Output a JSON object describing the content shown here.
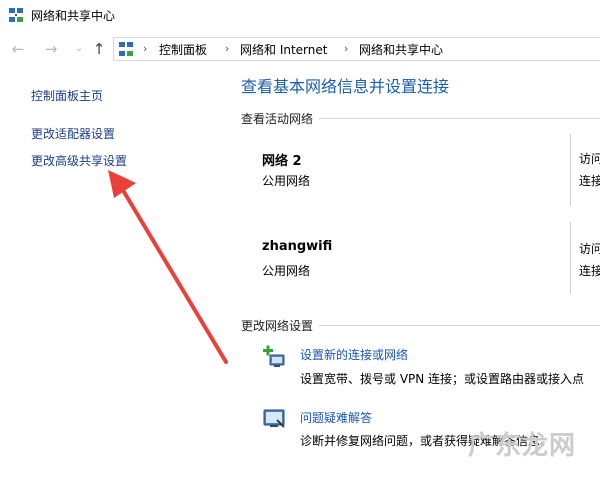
{
  "window": {
    "title": "网络和共享中心"
  },
  "nav": {
    "back_icon": "back-arrow-icon",
    "forward_icon": "forward-arrow-icon",
    "dropdown_icon": "chevron-down-icon",
    "up_icon": "up-arrow-icon"
  },
  "breadcrumb": {
    "items": [
      "控制面板",
      "网络和 Internet",
      "网络和共享中心"
    ]
  },
  "sidebar": {
    "items": [
      {
        "label": "控制面板主页"
      },
      {
        "label": "更改适配器设置"
      },
      {
        "label": "更改高级共享设置"
      }
    ]
  },
  "main": {
    "title": "查看基本网络信息并设置连接",
    "active_networks_label": "查看活动网络",
    "networks": [
      {
        "name": "网络 2",
        "type": "公用网络",
        "right_line1": "访问",
        "right_line2": "连接"
      },
      {
        "name": "zhangwifi",
        "type": "公用网络",
        "right_line1": "访问",
        "right_line2": "连接"
      }
    ],
    "change_settings_label": "更改网络设置",
    "tasks": [
      {
        "link": "设置新的连接或网络",
        "desc": "设置宽带、拨号或 VPN 连接；或设置路由器或接入点",
        "icon": "new-connection-icon"
      },
      {
        "link": "问题疑难解答",
        "desc": "诊断并修复网络问题，或者获得疑难解答信息。",
        "icon": "troubleshoot-icon"
      }
    ]
  },
  "annotation": {
    "arrow_color": "#e8413a"
  },
  "watermark": {
    "text": "广东龙网"
  },
  "colors": {
    "link": "#1a56b3",
    "title": "#1c5fa8"
  }
}
